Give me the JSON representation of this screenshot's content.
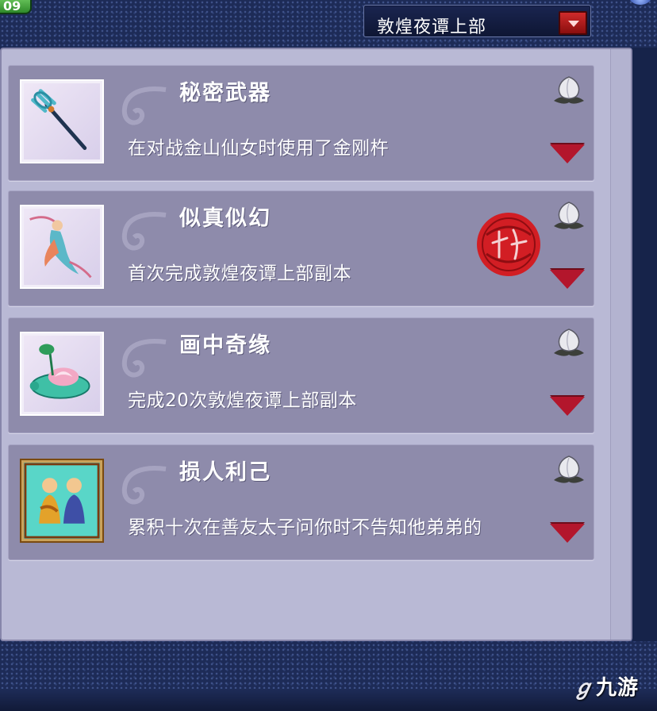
{
  "corner_badge": "09",
  "dropdown": {
    "selected": "敦煌夜谭上部"
  },
  "achievements": [
    {
      "title": "秘密武器",
      "desc": "在对战金山仙女时使用了金刚杵",
      "icon": "vajra-icon",
      "completed": false
    },
    {
      "title": "似真似幻",
      "desc": "首次完成敦煌夜谭上部副本",
      "icon": "flying-apsara-icon",
      "completed": true,
      "seal_text": "完成"
    },
    {
      "title": "画中奇缘",
      "desc": "完成20次敦煌夜谭上部副本",
      "icon": "lotus-turtle-icon",
      "completed": false
    },
    {
      "title": "损人利己",
      "desc": "累积十次在善友太子问你时不告知他弟弟的",
      "icon": "monks-icon",
      "completed": false
    }
  ],
  "watermark": {
    "logo": "九游"
  },
  "colors": {
    "panel": "#b9b9d5",
    "card": "#8e8bab",
    "expand_arrow": "#b3162c",
    "seal": "#d21e24",
    "dropdown_button": "#cf2b2b"
  }
}
